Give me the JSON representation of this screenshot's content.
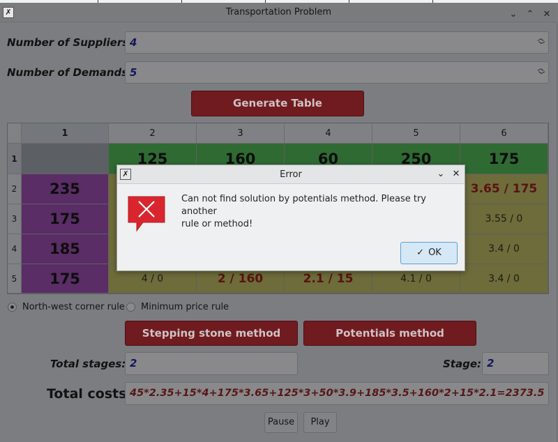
{
  "window": {
    "title": "Transportation Problem"
  },
  "form": {
    "suppliers_label": "Number of Suppliers:",
    "suppliers_value": "4",
    "demands_label": "Number of Demands:",
    "demands_value": "5",
    "generate_label": "Generate Table"
  },
  "table": {
    "col_headers": [
      "1",
      "2",
      "3",
      "4",
      "5",
      "6"
    ],
    "row_headers": [
      "1",
      "2",
      "3",
      "4",
      "5"
    ],
    "demands": [
      "125",
      "160",
      "60",
      "250",
      "175"
    ],
    "supplies": [
      "235",
      "175",
      "185",
      "175"
    ],
    "visible_cells": {
      "r2c6": "3.65 / 175",
      "r3c6": "3.55 / 0",
      "r4c6": "3.4 / 0",
      "r5c2": "4 / 0",
      "r5c3": "2 / 160",
      "r5c4": "2.1 / 15",
      "r5c5": "4.1 / 0",
      "r5c6": "3.4 / 0"
    }
  },
  "rules": {
    "nw_label": "North-west corner rule",
    "min_label": "Minimum price rule",
    "selected": "North-west corner rule"
  },
  "methods": {
    "stepping_label": "Stepping stone method",
    "potentials_label": "Potentials method"
  },
  "stages": {
    "total_label": "Total stages:",
    "total_value": "2",
    "stage_label": "Stage:",
    "stage_value": "2"
  },
  "costs": {
    "label": "Total costs:",
    "value": "45*2.35+15*4+175*3.65+125*3+50*3.9+185*3.5+160*2+15*2.1=2373.5"
  },
  "playback": {
    "pause_label": "Pause",
    "play_label": "Play"
  },
  "dialog": {
    "title": "Error",
    "message_line1": "Can not find solution by potentials method. Please try another",
    "message_line2": "rule or method!",
    "ok_label": "OK"
  },
  "colors": {
    "supply_cell": "#5a2d66",
    "demand_cell": "#2f6a33",
    "cost_cell": "#6d6c3a",
    "action_button": "#6f1b1f",
    "ok_button_border": "#5b9fd6",
    "error_icon": "#d9262e"
  }
}
